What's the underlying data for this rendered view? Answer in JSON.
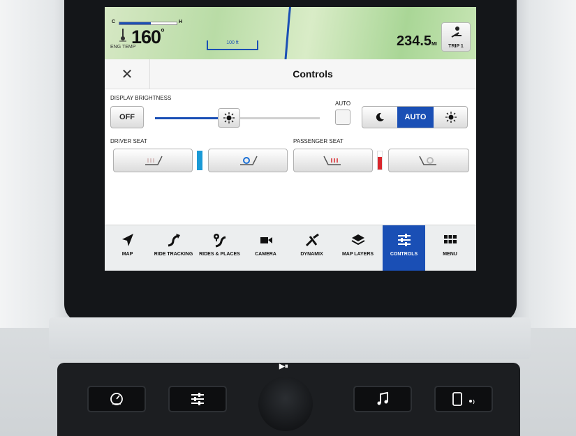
{
  "map": {
    "temp_low": "C",
    "temp_high": "H",
    "temp_value": "160",
    "temp_unit": "°",
    "temp_label": "ENG TEMP",
    "temp_level": 0.55,
    "scale_label": "100 ft",
    "odometer_value": "234.5",
    "odometer_unit": "MI",
    "trip_label": "TRIP 1"
  },
  "title": "Controls",
  "brightness": {
    "label": "DISPLAY BRIGHTNESS",
    "off_label": "OFF",
    "auto_label": "AUTO",
    "mode_auto": "AUTO",
    "level": 0.45
  },
  "seats": {
    "driver_label": "DRIVER SEAT",
    "passenger_label": "PASSENGER SEAT"
  },
  "colors": {
    "accent": "#1a4fb5",
    "cool": "#1a9ad6",
    "heat": "#d9262c"
  },
  "nav": [
    {
      "label": "MAP",
      "icon": "navigation-arrow-icon"
    },
    {
      "label": "RIDE TRACKING",
      "icon": "route-icon"
    },
    {
      "label": "RIDES & PLACES",
      "icon": "pin-route-icon"
    },
    {
      "label": "CAMERA",
      "icon": "camera-icon"
    },
    {
      "label": "DYNAMIX",
      "icon": "dynamix-icon"
    },
    {
      "label": "MAP LAYERS",
      "icon": "layers-icon"
    },
    {
      "label": "CONTROLS",
      "icon": "sliders-icon",
      "selected": true
    },
    {
      "label": "MENU",
      "icon": "grid-icon"
    }
  ],
  "hardware": {
    "play_pause": "▶⏸"
  }
}
